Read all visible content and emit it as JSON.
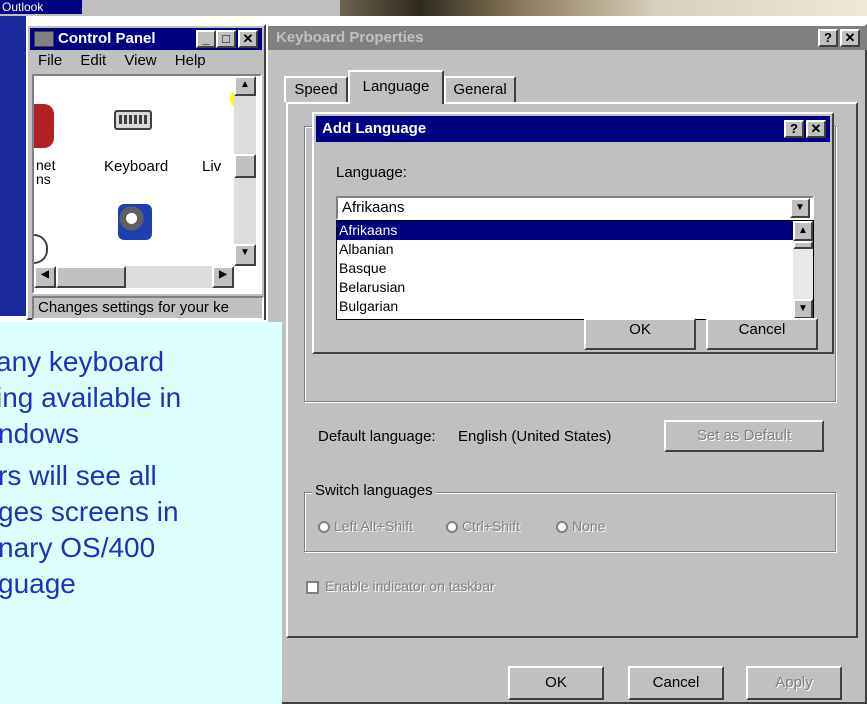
{
  "desktop": {
    "outlook_label": "Outlook"
  },
  "control_panel": {
    "title": "Control Panel",
    "menu": [
      "File",
      "Edit",
      "View",
      "Help"
    ],
    "icons": [
      {
        "label": "net\nns",
        "icon": "network-icon"
      },
      {
        "label": "Keyboard",
        "icon": "keyboard-icon"
      },
      {
        "label": "Liv",
        "icon": "live-icon"
      }
    ],
    "status": "Changes settings for your ke"
  },
  "keyboard_properties": {
    "title": "Keyboard Properties",
    "tabs": [
      "Speed",
      "Language",
      "General"
    ],
    "active_tab": "Language",
    "default_language_label": "Default language:",
    "default_language_value": "English (United States)",
    "set_default_button": "Set as Default",
    "switch_group_label": "Switch languages",
    "switch_options": [
      "Left Alt+Shift",
      "Ctrl+Shift",
      "None"
    ],
    "indicator_checkbox": "Enable indicator on taskbar",
    "buttons": {
      "ok": "OK",
      "cancel": "Cancel",
      "apply": "Apply"
    }
  },
  "add_language": {
    "title": "Add Language",
    "field_label": "Language:",
    "selected": "Afrikaans",
    "options": [
      "Afrikaans",
      "Albanian",
      "Basque",
      "Belarusian",
      "Bulgarian"
    ],
    "ok": "OK",
    "cancel": "Cancel"
  },
  "callout": {
    "lines": [
      "any keyboard",
      "ing available in",
      "ndows",
      "rs will see all",
      "ges screens in",
      "nary OS/400",
      "guage"
    ]
  },
  "colors": {
    "title_active": "#000080",
    "title_inactive": "#808080",
    "callout_bg": "#ddfffe",
    "callout_text": "#1a35b8"
  }
}
